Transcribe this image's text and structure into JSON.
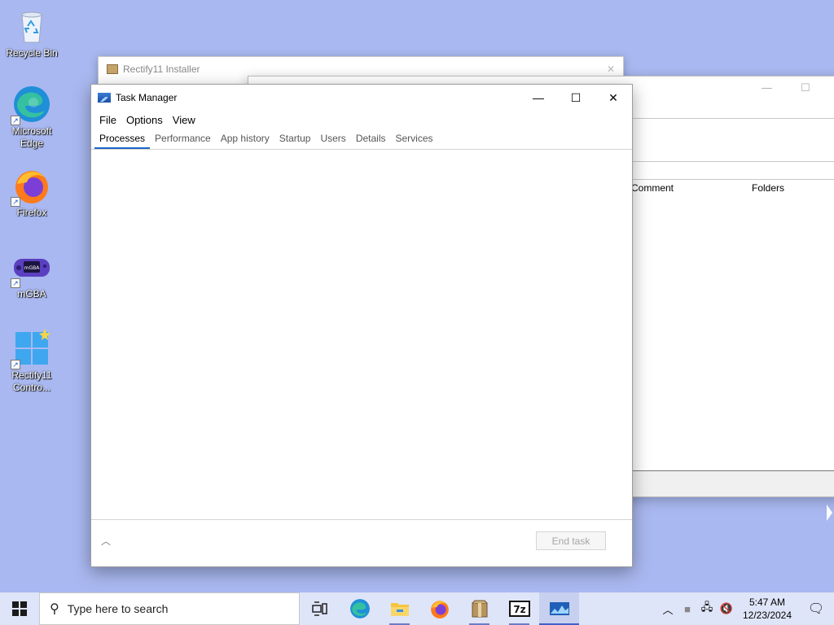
{
  "desktop": {
    "icons": [
      {
        "label": "Recycle Bin"
      },
      {
        "label": "Microsoft Edge"
      },
      {
        "label": "Firefox"
      },
      {
        "label": "mGBA"
      },
      {
        "label": "Rectify11 Contro..."
      }
    ]
  },
  "installer_window": {
    "title": "Rectify11 Installer"
  },
  "archive_window": {
    "columns": [
      "Comment",
      "Folders"
    ]
  },
  "task_manager": {
    "title": "Task Manager",
    "menu": [
      "File",
      "Options",
      "View"
    ],
    "tabs": [
      "Processes",
      "Performance",
      "App history",
      "Startup",
      "Users",
      "Details",
      "Services"
    ],
    "active_tab": "Processes",
    "end_task_label": "End task"
  },
  "taskbar": {
    "search_placeholder": "Type here to search",
    "pinned": [
      "task-view",
      "edge",
      "file-explorer",
      "firefox",
      "archive-app",
      "7zip",
      "task-manager"
    ],
    "clock_time": "5:47 AM",
    "clock_date": "12/23/2024"
  },
  "colors": {
    "desktop_bg": "#a9b8f0",
    "taskbar_bg": "#dfe5f8",
    "accent": "#1a66c9"
  }
}
